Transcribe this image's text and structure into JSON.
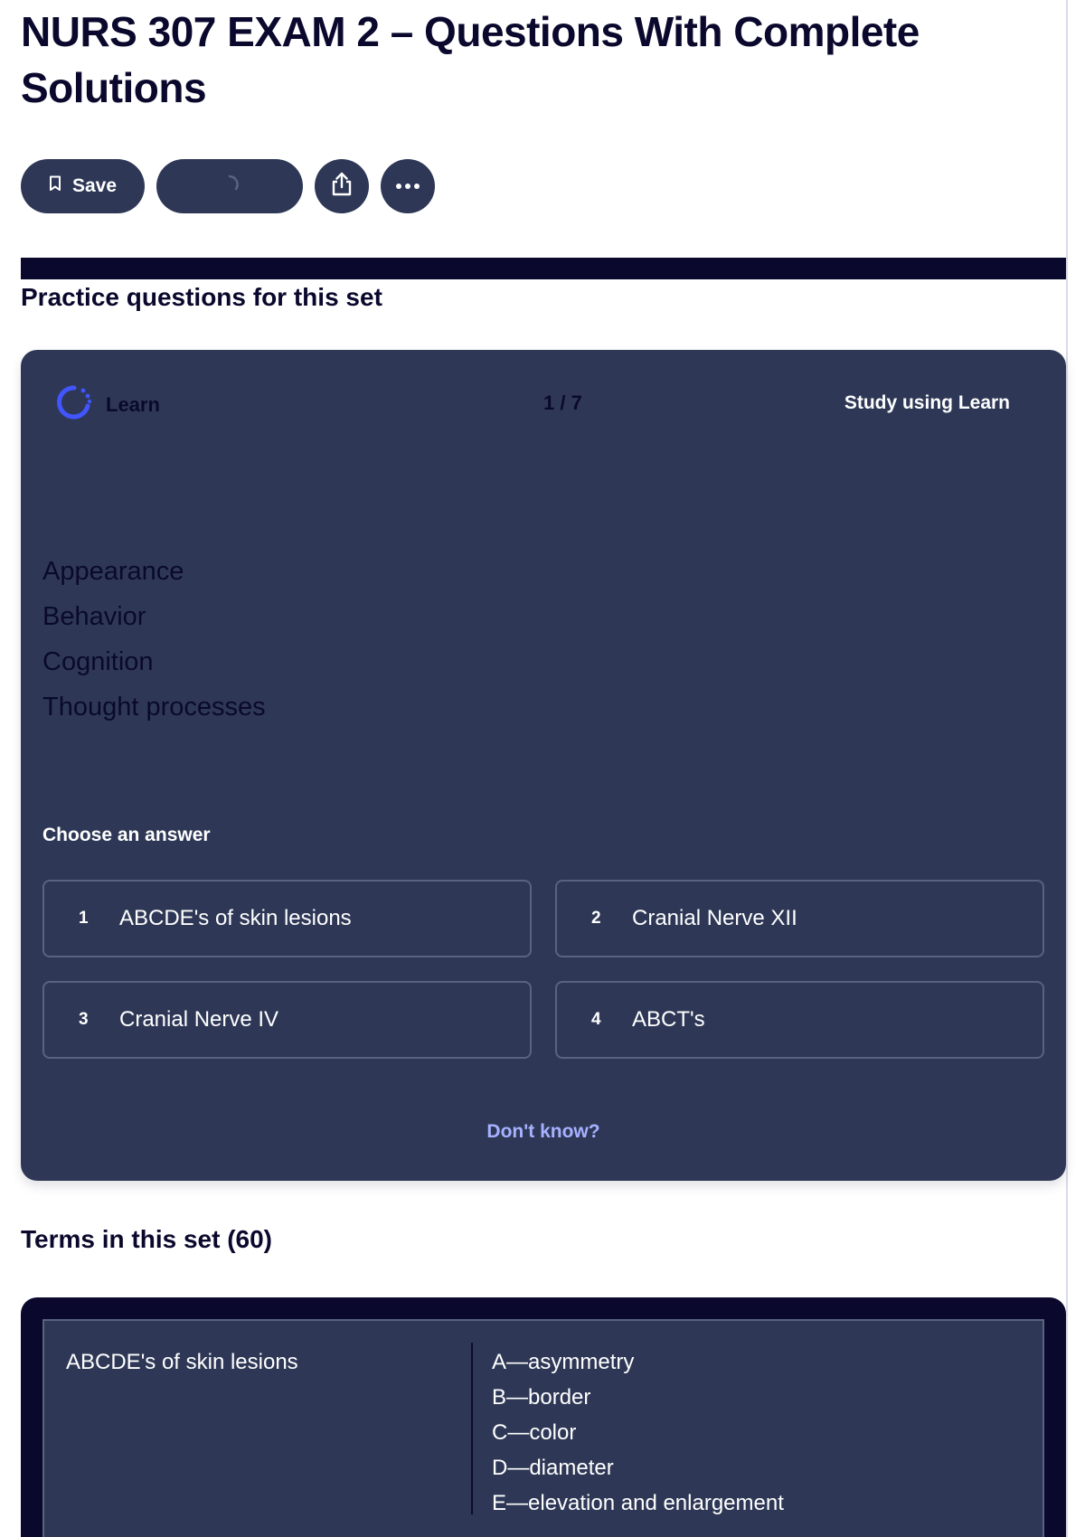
{
  "page": {
    "title": "NURS 307 EXAM 2 – Questions With Complete Solutions"
  },
  "toolbar": {
    "save_label": "Save",
    "save_icon": "bookmark-icon",
    "loading_icon": "spinner-icon",
    "share_icon": "share-icon",
    "more_icon": "more-dots-icon"
  },
  "practice": {
    "heading": "Practice questions for this set",
    "learn_label": "Learn",
    "progress": "1 / 7",
    "study_link": "Study using Learn",
    "prompt": [
      "Appearance",
      "Behavior",
      "Cognition",
      "Thought processes"
    ],
    "choose_label": "Choose an answer",
    "options": [
      {
        "num": "1",
        "text": "ABCDE's of skin lesions"
      },
      {
        "num": "2",
        "text": "Cranial Nerve XII"
      },
      {
        "num": "3",
        "text": "Cranial Nerve IV"
      },
      {
        "num": "4",
        "text": "ABCT's"
      }
    ],
    "dont_know": "Don't know?"
  },
  "terms": {
    "heading": "Terms in this set (60)",
    "items": [
      {
        "term": "ABCDE's of skin lesions",
        "definition": [
          "A—asymmetry",
          "B—border",
          "C—color",
          "D—diameter",
          "E—elevation and enlargement"
        ]
      }
    ]
  },
  "colors": {
    "navy": "#0a092d",
    "card": "#2e3856",
    "border": "#586380",
    "accent": "#4255ff",
    "link": "#a8b1ff"
  }
}
